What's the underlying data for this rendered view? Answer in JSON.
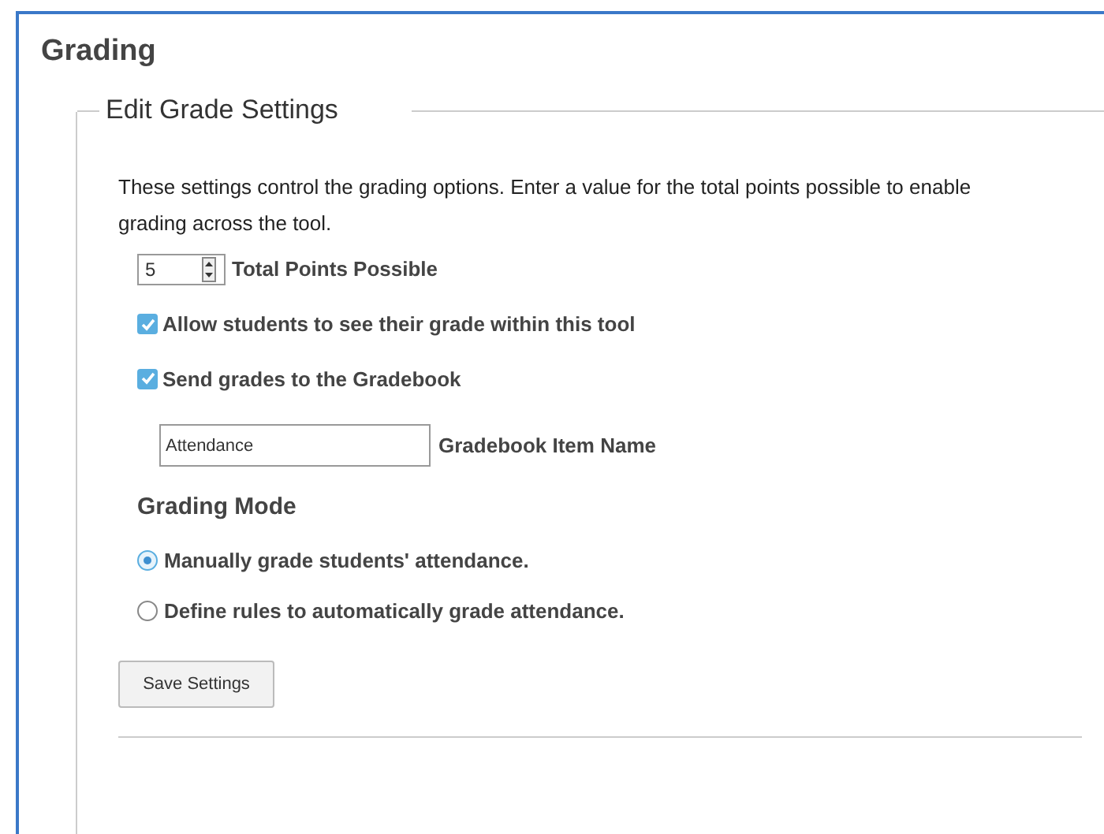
{
  "title": "Grading",
  "fieldset": {
    "legend": "Edit Grade Settings",
    "intro": "These settings control the grading options. Enter a value for the total points possible to enable grading across the tool.",
    "points": {
      "value": "5",
      "label": "Total Points Possible"
    },
    "checkboxes": [
      {
        "label": "Allow students to see their grade within this tool",
        "checked": true
      },
      {
        "label": "Send grades to the Gradebook",
        "checked": true
      }
    ],
    "item_name": {
      "value": "Attendance",
      "label": "Gradebook Item Name"
    },
    "mode_heading": "Grading Mode",
    "modes": [
      {
        "label": "Manually grade students' attendance.",
        "selected": true
      },
      {
        "label": "Define rules to automatically grade attendance.",
        "selected": false
      }
    ],
    "save_button": "Save Settings"
  }
}
